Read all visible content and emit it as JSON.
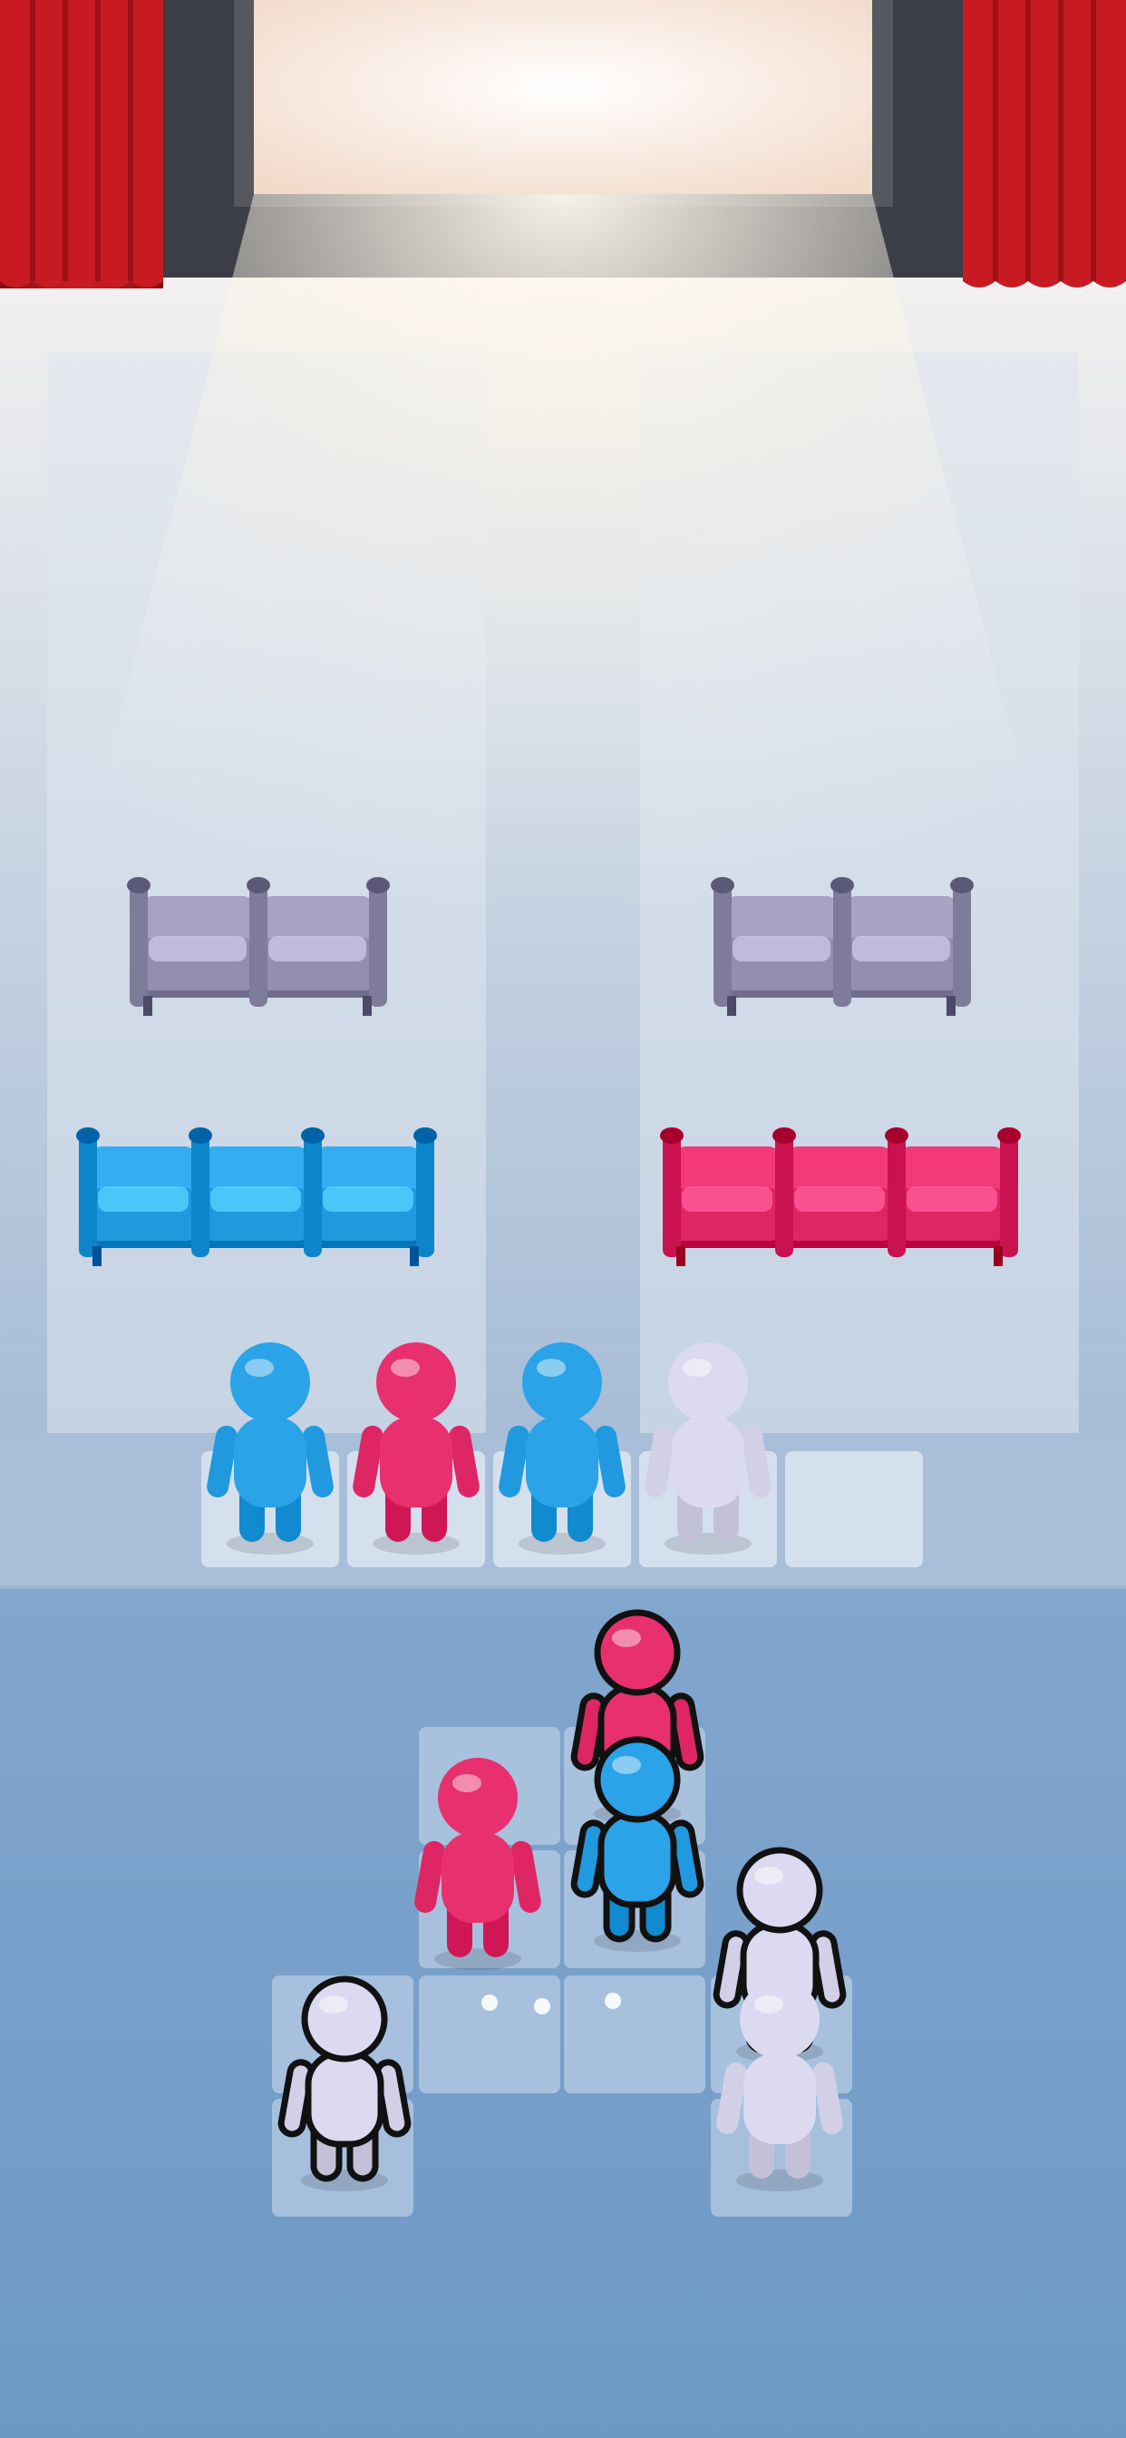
{
  "game": {
    "screen": "cinema-seating-puzzle",
    "seat_rows": [
      {
        "id": "row-left-gray",
        "color": "gray",
        "seats": 2
      },
      {
        "id": "row-right-gray",
        "color": "gray",
        "seats": 2
      },
      {
        "id": "row-left-blue",
        "color": "blue",
        "seats": 3
      },
      {
        "id": "row-right-pink",
        "color": "pink",
        "seats": 3
      }
    ],
    "queue": {
      "slots": 5,
      "figures": [
        "blue",
        "pink",
        "blue",
        "white",
        null
      ]
    },
    "board": {
      "figures": [
        {
          "id": "board-pink-top",
          "color": "pink",
          "outlined": true
        },
        {
          "id": "board-blue-mid",
          "color": "blue",
          "outlined": true
        },
        {
          "id": "board-pink-left",
          "color": "pink",
          "outlined": false
        },
        {
          "id": "board-white-right-top",
          "color": "white",
          "outlined": true
        },
        {
          "id": "board-white-right-bottom",
          "color": "white",
          "outlined": false
        },
        {
          "id": "board-white-left",
          "color": "white",
          "outlined": true
        }
      ]
    },
    "colors": {
      "blue": "#2aa3e8",
      "pink": "#e8306e",
      "white": "#dcdaf0",
      "gray": "#9c9ab8",
      "curtain": "#c0141e",
      "floor": "#8fb0d3"
    }
  }
}
